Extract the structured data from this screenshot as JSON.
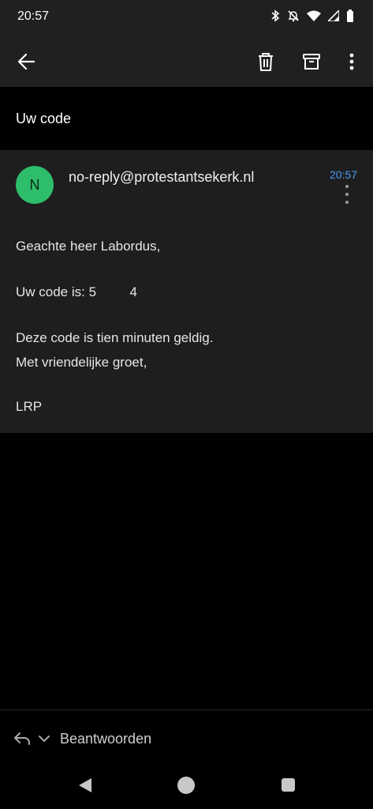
{
  "status_bar": {
    "time": "20:57",
    "icons": [
      "bluetooth-icon",
      "bell-off-icon",
      "wifi-icon",
      "signal-icon",
      "battery-icon"
    ]
  },
  "toolbar": {
    "back_icon": "arrow-left-icon",
    "delete_icon": "trash-icon",
    "archive_icon": "archive-icon",
    "more_icon": "more-vertical-icon"
  },
  "email": {
    "subject": "Uw code",
    "avatar_letter": "N",
    "avatar_color": "#2ebd6a",
    "sender": "no-reply@protestantsekerk.nl",
    "time": "20:57",
    "time_color": "#4a9df6",
    "body": {
      "greeting": "Geachte heer Labordus,",
      "code_line": "Uw code is: 5         4",
      "validity": "Deze code is tien minuten geldig.",
      "closing": "Met vriendelijke groet,",
      "signature": "LRP"
    }
  },
  "reply_bar": {
    "label": "Beantwoorden"
  }
}
